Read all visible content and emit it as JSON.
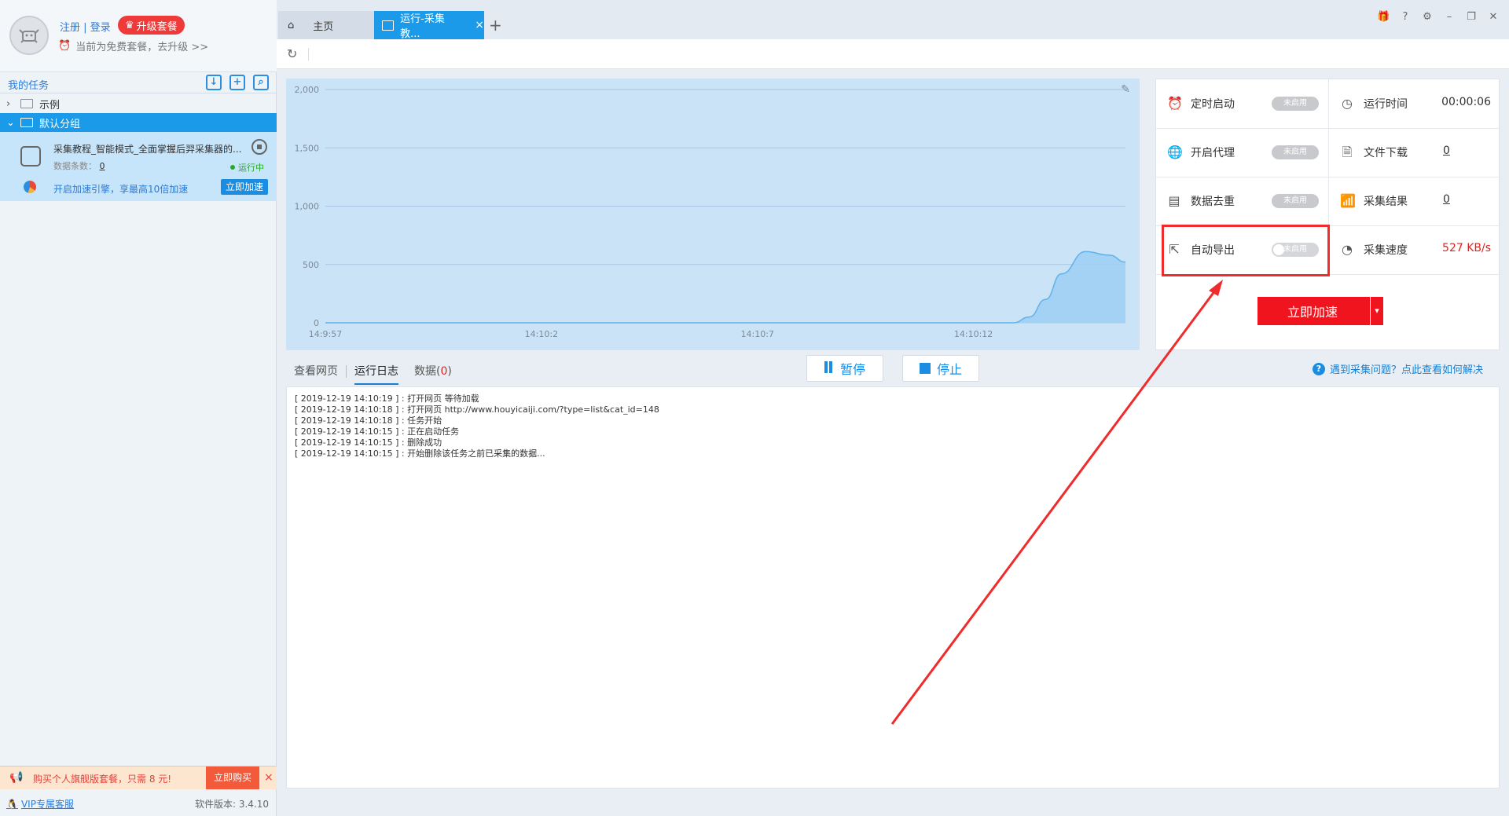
{
  "user": {
    "register_login": "注册 | 登录",
    "upgrade_label": "升级套餐",
    "plan_note": "当前为免费套餐，去升级 >>"
  },
  "sidebar": {
    "title": "我的任务",
    "groups": [
      {
        "label": "示例",
        "expanded": false
      },
      {
        "label": "默认分组",
        "expanded": true
      }
    ],
    "task": {
      "name": "采集教程_智能模式_全面掌握后羿采集器的...",
      "count_label": "数据条数：",
      "count_value": "0",
      "status": "运行中",
      "promo": "开启加速引擎，享最高10倍加速",
      "speed_button": "立即加速"
    },
    "promo_bar": {
      "text": "购买个人旗舰版套餐，只需 8 元!",
      "buy": "立即购买",
      "close": "×"
    },
    "footer": {
      "vip": "VIP专属客服",
      "version": "软件版本: 3.4.10"
    }
  },
  "tabs": [
    {
      "label": "主页",
      "active": false
    },
    {
      "label": "运行-采集教...",
      "active": true
    }
  ],
  "tab_add": "+",
  "chart_data": {
    "type": "area",
    "x_tick_labels": [
      "14:9:57",
      "14:10:2",
      "14:10:7",
      "14:10:12"
    ],
    "y_tick_labels": [
      "0",
      "500",
      "1,000",
      "1,500",
      "2,000"
    ],
    "ylim": [
      0,
      2000
    ],
    "grid": true,
    "series": [
      {
        "x": [
          0,
          0.2,
          0.4,
          0.6,
          0.75,
          0.86,
          0.88,
          0.9,
          0.92,
          0.95,
          0.98,
          1.0
        ],
        "values": [
          0,
          0,
          0,
          0,
          0,
          0,
          50,
          200,
          420,
          610,
          580,
          520
        ]
      }
    ]
  },
  "stats": {
    "scheduled_start": {
      "label": "定时启动",
      "state": "未启用"
    },
    "run_time": {
      "label": "运行时间",
      "value": "00:00:06"
    },
    "proxy": {
      "label": "开启代理",
      "state": "未启用"
    },
    "file_download": {
      "label": "文件下载",
      "value": "0"
    },
    "dedupe": {
      "label": "数据去重",
      "state": "未启用"
    },
    "results": {
      "label": "采集结果",
      "value": "0"
    },
    "auto_export": {
      "label": "自动导出",
      "state": "未启用"
    },
    "speed": {
      "label": "采集速度",
      "value": "527 KB/s"
    },
    "accelerate_button": "立即加速"
  },
  "log_tabs": {
    "view_page": "查看网页",
    "run_log": "运行日志",
    "data_label": "数据(",
    "data_count": "0",
    "data_close": ")"
  },
  "controls": {
    "pause": "暂停",
    "stop": "停止"
  },
  "help": "遇到采集问题？点此查看如何解决",
  "log_lines": [
    "[ 2019-12-19 14:10:19 ] : 打开网页 等待加载",
    "[ 2019-12-19 14:10:18 ] : 打开网页 http://www.houyicaiji.com/?type=list&cat_id=148",
    "[ 2019-12-19 14:10:18 ] : 任务开始",
    "[ 2019-12-19 14:10:15 ] : 正在启动任务",
    "[ 2019-12-19 14:10:15 ] : 删除成功",
    "[ 2019-12-19 14:10:15 ] : 开始删除该任务之前已采集的数据..."
  ],
  "colors": {
    "accent_blue": "#1a9ae8",
    "chart_fill": "#9ccff3",
    "danger_red": "#f0141e",
    "annotation_red": "#f02b2b"
  }
}
